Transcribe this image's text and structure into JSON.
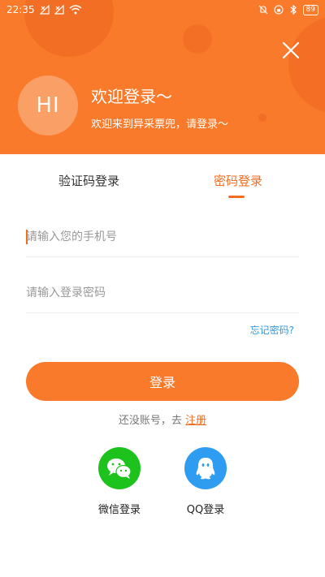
{
  "status_bar": {
    "time": "22:35",
    "battery": "89"
  },
  "header": {
    "avatar_text": "HI",
    "title": "欢迎登录～",
    "subtitle": "欢迎来到异采票兜，请登录～"
  },
  "tabs": [
    {
      "label": "验证码登录",
      "active": false
    },
    {
      "label": "密码登录",
      "active": true
    }
  ],
  "form": {
    "phone_placeholder": "请输入您的手机号",
    "password_placeholder": "请输入登录密码",
    "forgot_label": "忘记密码?",
    "login_label": "登录"
  },
  "register": {
    "prompt": "还没账号，去",
    "link": "注册"
  },
  "social": [
    {
      "label": "微信登录",
      "icon": "wechat-icon",
      "color": "#1dc21d"
    },
    {
      "label": "QQ登录",
      "icon": "qq-icon",
      "color": "#2e9cf0"
    }
  ],
  "colors": {
    "accent": "#f97a2b",
    "link": "#2d9ae0"
  }
}
